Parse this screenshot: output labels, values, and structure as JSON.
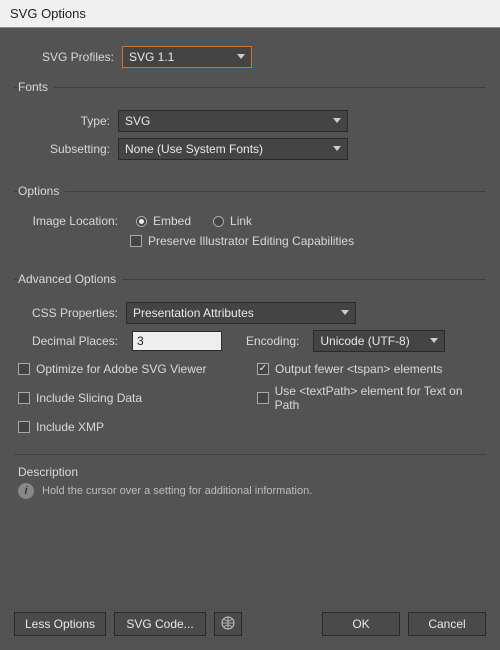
{
  "title": "SVG Options",
  "profiles": {
    "label": "SVG Profiles:",
    "value": "SVG 1.1"
  },
  "fonts": {
    "legend": "Fonts",
    "type": {
      "label": "Type:",
      "value": "SVG"
    },
    "subsetting": {
      "label": "Subsetting:",
      "value": "None (Use System Fonts)"
    }
  },
  "options": {
    "legend": "Options",
    "imageLocation": {
      "label": "Image Location:",
      "embed": "Embed",
      "link": "Link",
      "selected": "embed"
    },
    "preserve": "Preserve Illustrator Editing Capabilities"
  },
  "advanced": {
    "legend": "Advanced Options",
    "css": {
      "label": "CSS Properties:",
      "value": "Presentation Attributes"
    },
    "decimal": {
      "label": "Decimal Places:",
      "value": "3"
    },
    "encoding": {
      "label": "Encoding:",
      "value": "Unicode (UTF-8)"
    },
    "optimize": "Optimize for Adobe SVG Viewer",
    "outputTspan": "Output fewer <tspan> elements",
    "slicing": "Include Slicing Data",
    "textPath": "Use <textPath> element for Text on Path",
    "xmp": "Include XMP"
  },
  "description": {
    "legend": "Description",
    "text": "Hold the cursor over a setting for additional information."
  },
  "footer": {
    "lessOptions": "Less Options",
    "svgCode": "SVG Code...",
    "ok": "OK",
    "cancel": "Cancel"
  }
}
